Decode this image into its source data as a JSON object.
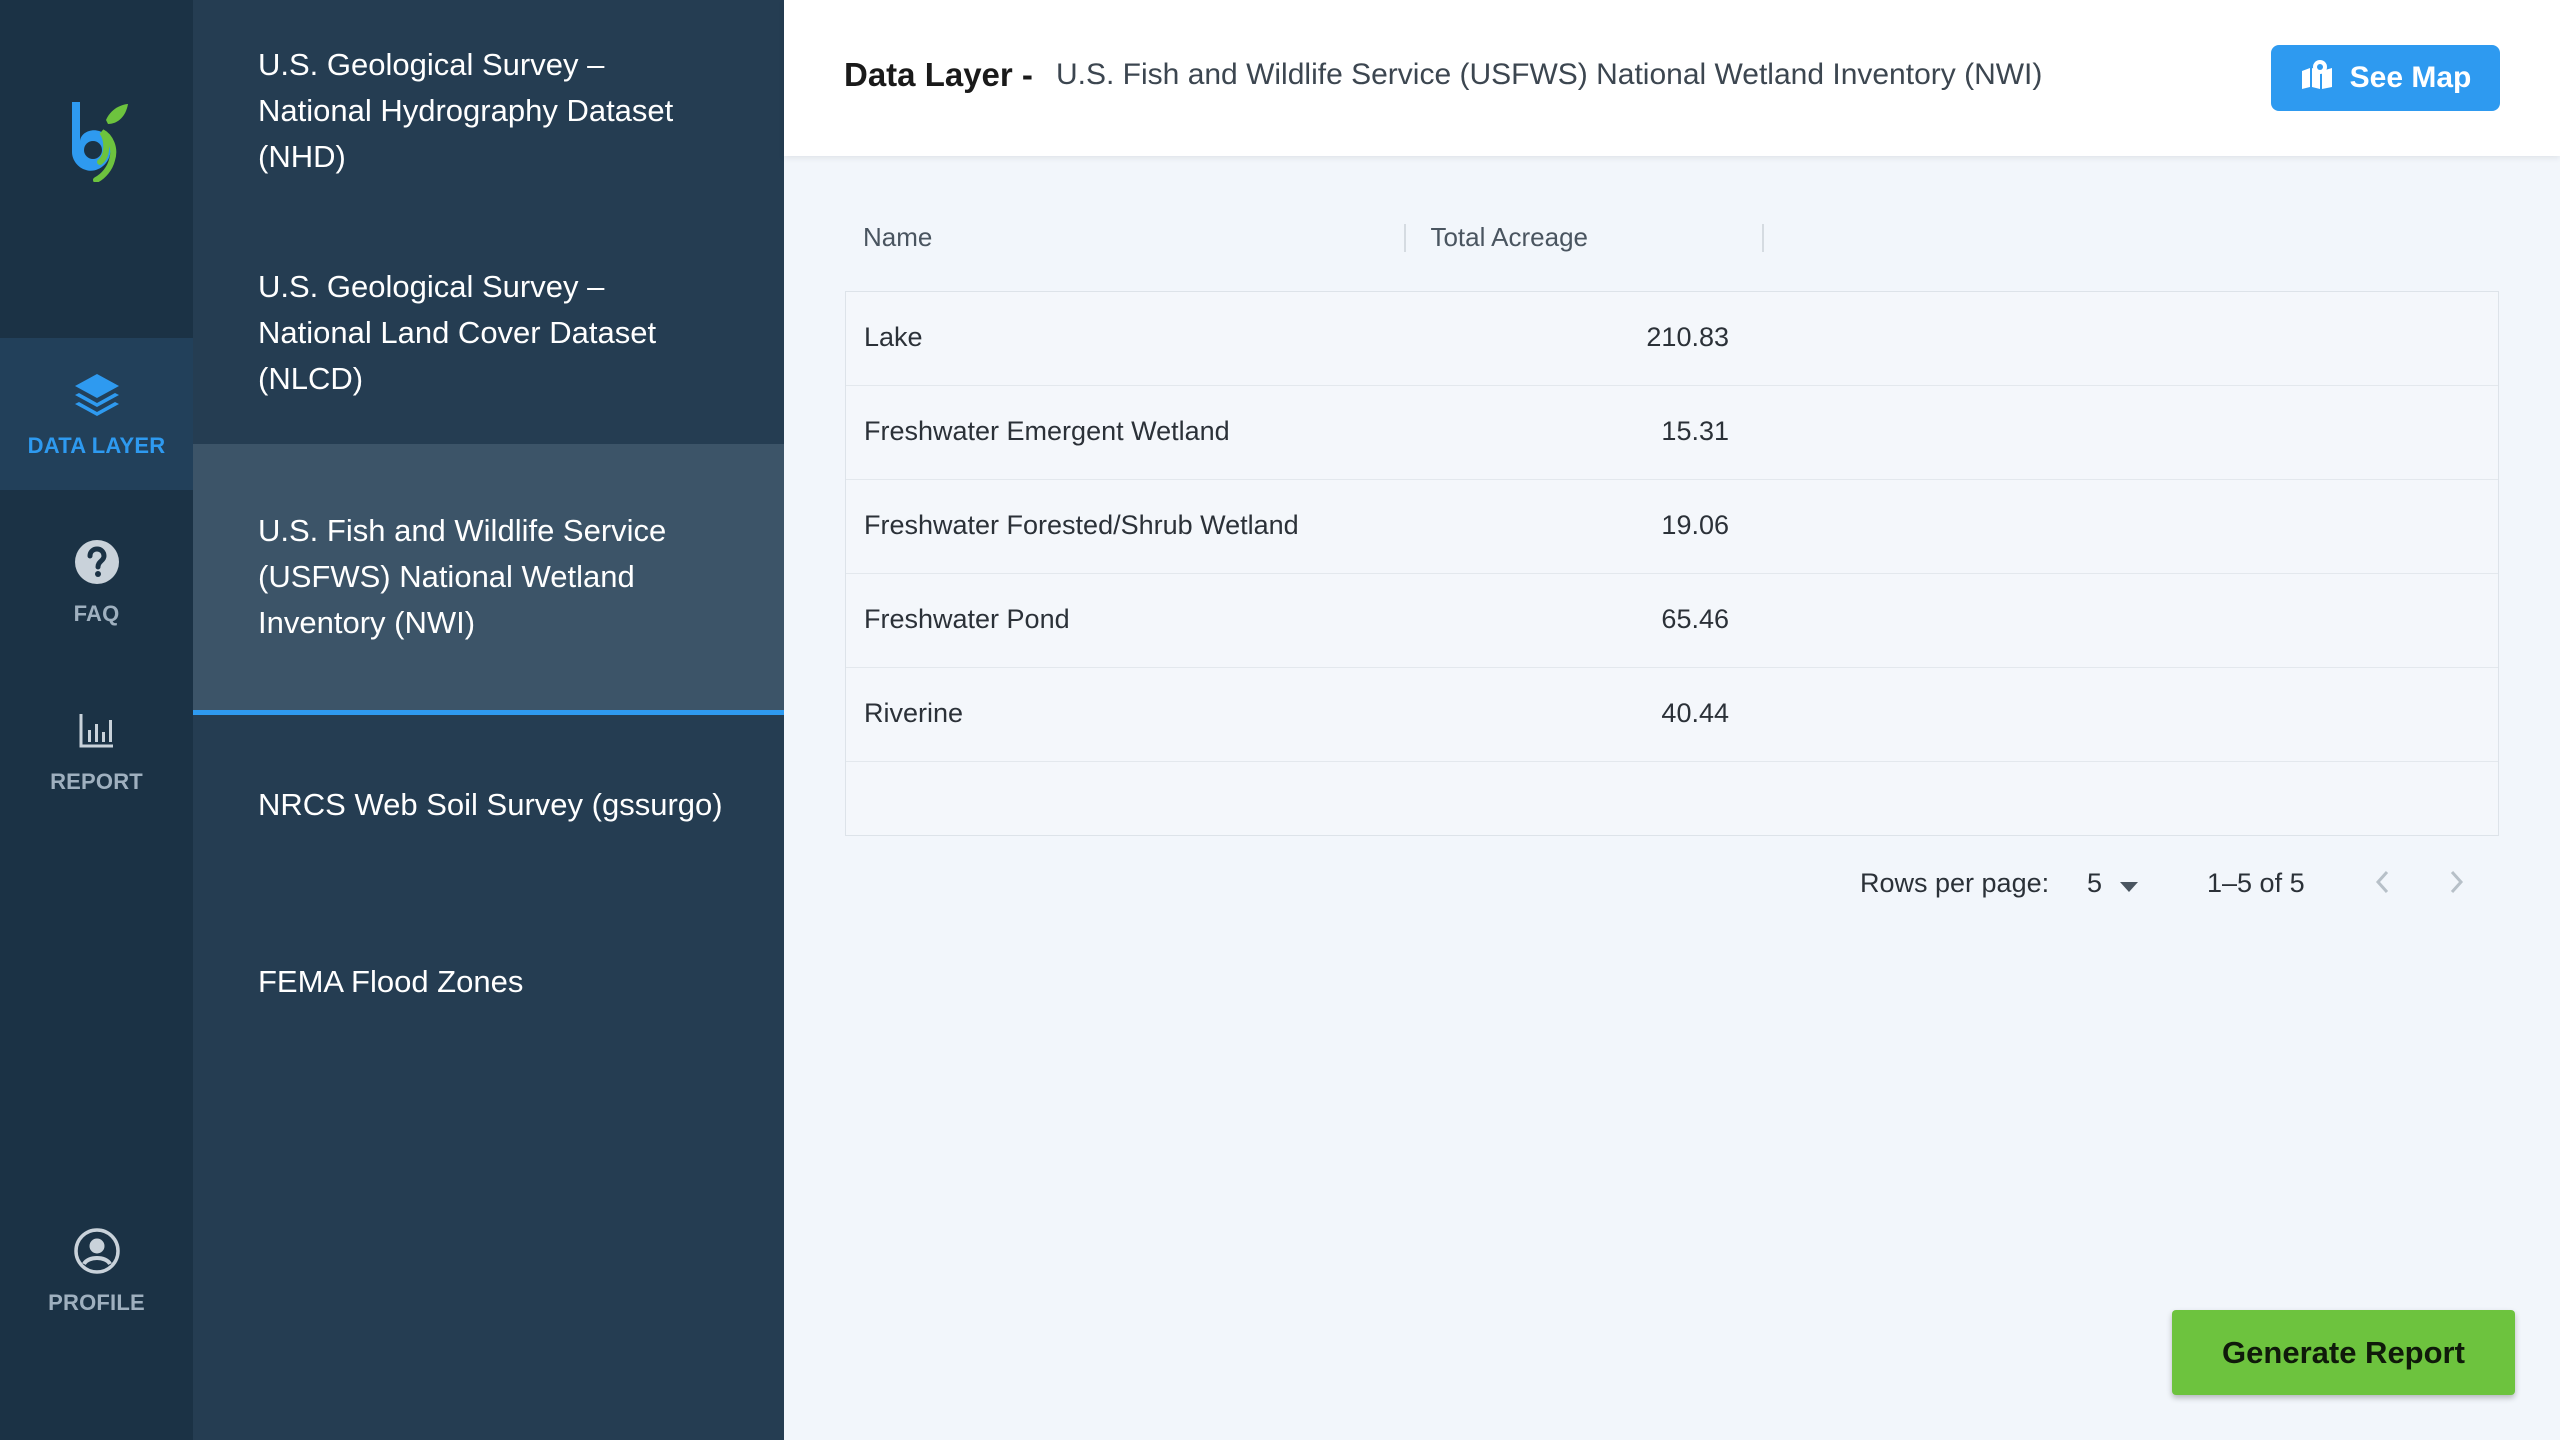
{
  "nav": {
    "items": [
      {
        "label": "DATA LAYER",
        "icon": "layers-icon"
      },
      {
        "label": "FAQ",
        "icon": "help-circle-icon"
      },
      {
        "label": "REPORT",
        "icon": "bar-chart-icon"
      },
      {
        "label": "PROFILE",
        "icon": "account-circle-icon"
      }
    ],
    "active": "DATA LAYER",
    "accent_color": "#2e9af0"
  },
  "layers": [
    {
      "label": "U.S. Geological Survey – National Hydrography Dataset (NHD)"
    },
    {
      "label": "U.S. Geological Survey – National Land Cover Dataset (NLCD)"
    },
    {
      "label": "U.S. Fish and Wildlife Service (USFWS) National Wetland Inventory (NWI)"
    },
    {
      "label": "NRCS Web Soil Survey (gssurgo)"
    },
    {
      "label": "FEMA Flood Zones"
    }
  ],
  "selected_layer": "U.S. Fish and Wildlife Service (USFWS) National Wetland Inventory (NWI)",
  "header": {
    "title": "Data Layer -",
    "subtitle": "U.S. Fish and Wildlife Service (USFWS) National Wetland Inventory (NWI)",
    "see_map_label": "See Map",
    "see_map_icon": "map-marker-icon"
  },
  "table": {
    "columns": [
      "Name",
      "Total Acreage"
    ],
    "rows": [
      {
        "name": "Lake",
        "acreage": "210.83"
      },
      {
        "name": "Freshwater Emergent Wetland",
        "acreage": "15.31"
      },
      {
        "name": "Freshwater Forested/Shrub Wetland",
        "acreage": "19.06"
      },
      {
        "name": "Freshwater Pond",
        "acreage": "65.46"
      },
      {
        "name": "Riverine",
        "acreage": "40.44"
      }
    ]
  },
  "pagination": {
    "rows_per_page_label": "Rows per page:",
    "rows_per_page_value": "5",
    "range_text": "1–5 of 5"
  },
  "actions": {
    "generate_report_label": "Generate Report",
    "generate_report_color": "#6dc33e"
  }
}
